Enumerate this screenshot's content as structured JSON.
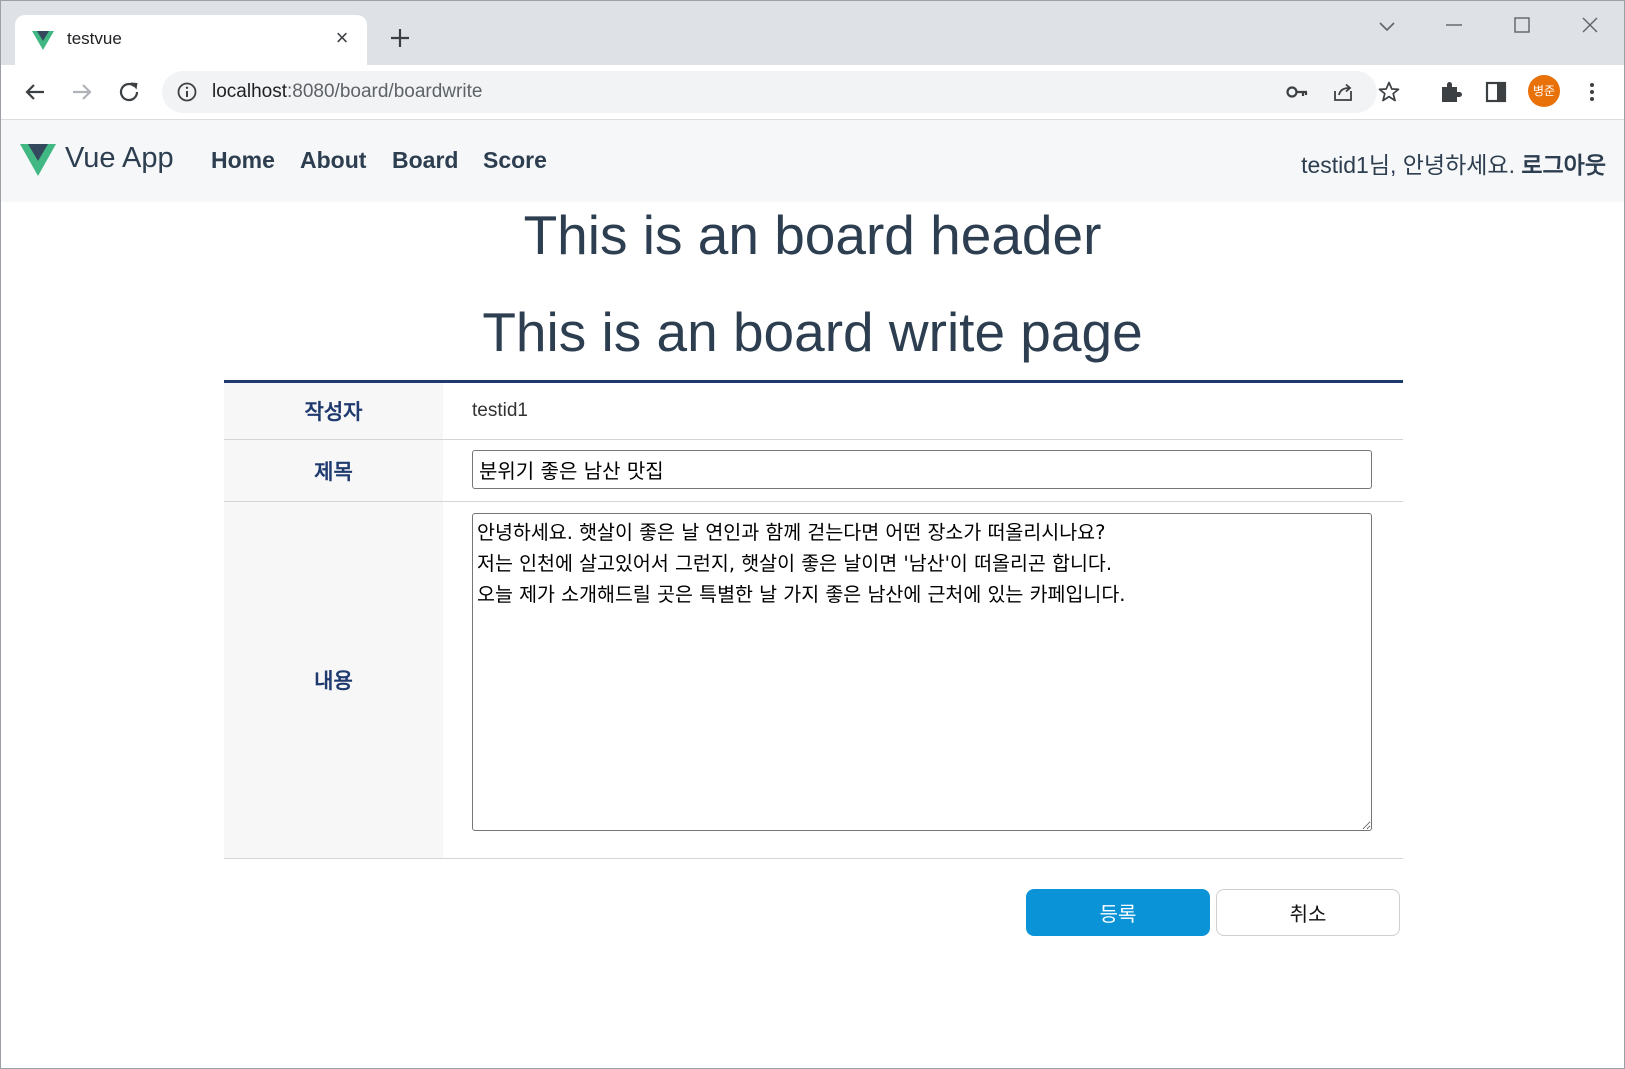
{
  "browser": {
    "tab_title": "testvue",
    "url_host": "localhost",
    "url_rest": ":8080/board/boardwrite",
    "profile_initials": "병준",
    "profile_color": "#e8710a"
  },
  "app": {
    "brand": "Vue App",
    "nav": [
      {
        "label": "Home"
      },
      {
        "label": "About"
      },
      {
        "label": "Board"
      },
      {
        "label": "Score"
      }
    ],
    "greeting": "testid1님, 안녕하세요.",
    "logout_label": "로그아웃"
  },
  "page": {
    "header": "This is an board header",
    "subheader": "This is an board write page"
  },
  "form": {
    "writer_label": "작성자",
    "writer_value": "testid1",
    "title_label": "제목",
    "title_value": "분위기 좋은 남산 맛집",
    "content_label": "내용",
    "content_value": "안녕하세요. 햇살이 좋은 날 연인과 함께 걷는다면 어떤 장소가 떠올리시나요?\n저는 인천에 살고있어서 그런지, 햇살이 좋은 날이면 '남산'이 떠올리곤 합니다.\n오늘 제가 소개해드릴 곳은 특별한 날 가지 좋은 남산에 근처에 있는 카페입니다.",
    "submit_label": "등록",
    "cancel_label": "취소"
  },
  "colors": {
    "accent": "#0a93d6",
    "label_text": "#1f3a6e",
    "heading_text": "#2c3e50"
  }
}
